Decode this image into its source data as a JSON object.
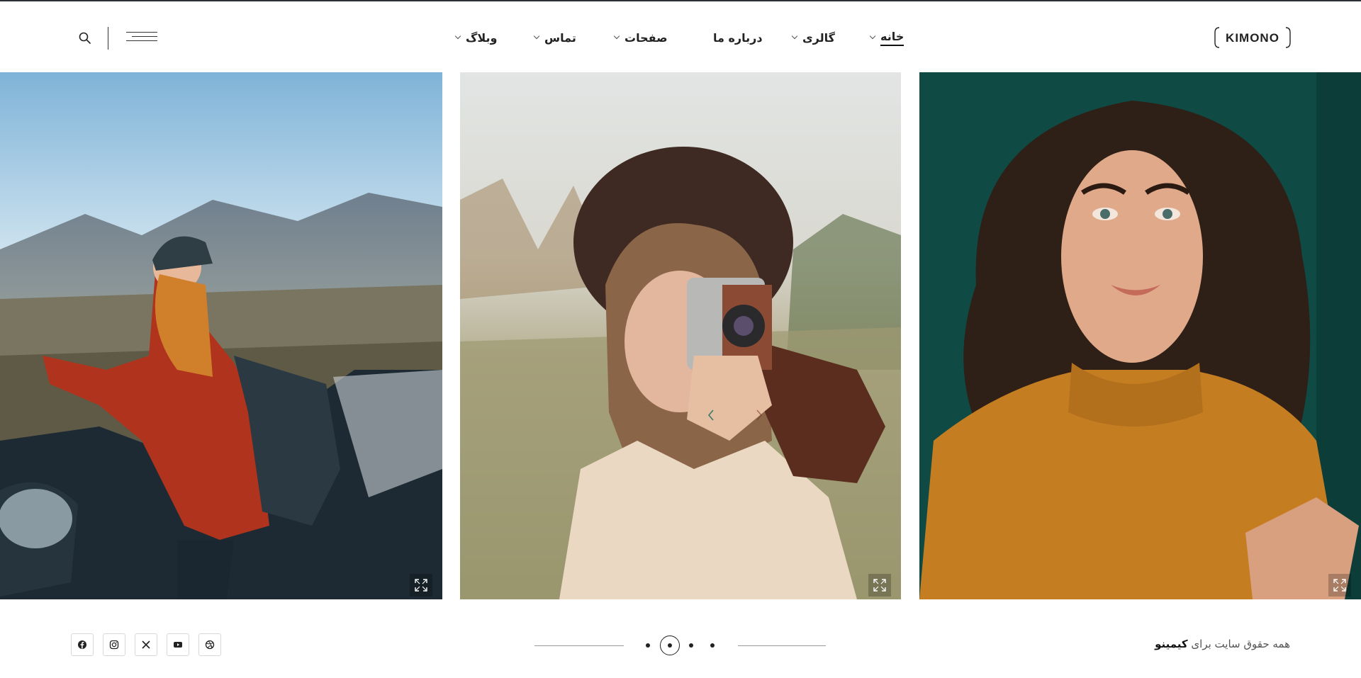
{
  "brand": {
    "logo_text": "KIMONO"
  },
  "nav": {
    "items": [
      {
        "label": "خانه",
        "has_dropdown": true,
        "active": true
      },
      {
        "label": "گالری",
        "has_dropdown": true
      },
      {
        "label": "درباره ما",
        "has_dropdown": false
      },
      {
        "label": "صفحات",
        "has_dropdown": true
      },
      {
        "label": "تماس",
        "has_dropdown": true
      },
      {
        "label": "وبلاگ",
        "has_dropdown": true
      }
    ]
  },
  "header_tools": {
    "search_icon": "search-icon",
    "menu_icon": "hamburger-menu-icon"
  },
  "gallery": {
    "photos": [
      {
        "subject": "woman-in-orange-sweater-portrait",
        "expand_icon": "expand-icon"
      },
      {
        "subject": "woman-with-vintage-camera",
        "expand_icon": "expand-icon"
      },
      {
        "subject": "hiker-woman-by-car-mountains",
        "expand_icon": "expand-icon"
      }
    ]
  },
  "footer": {
    "copyright_prefix": "همه حقوق سایت برای",
    "copyright_brand": "کیمینو",
    "slider": {
      "total": 4,
      "active_index": 2
    },
    "socials": [
      {
        "name": "dribbble-icon"
      },
      {
        "name": "youtube-icon"
      },
      {
        "name": "x-icon"
      },
      {
        "name": "instagram-icon"
      },
      {
        "name": "facebook-icon"
      }
    ]
  },
  "colors": {
    "accent": "#2b2f33",
    "text": "#222222",
    "muted": "#999999"
  }
}
